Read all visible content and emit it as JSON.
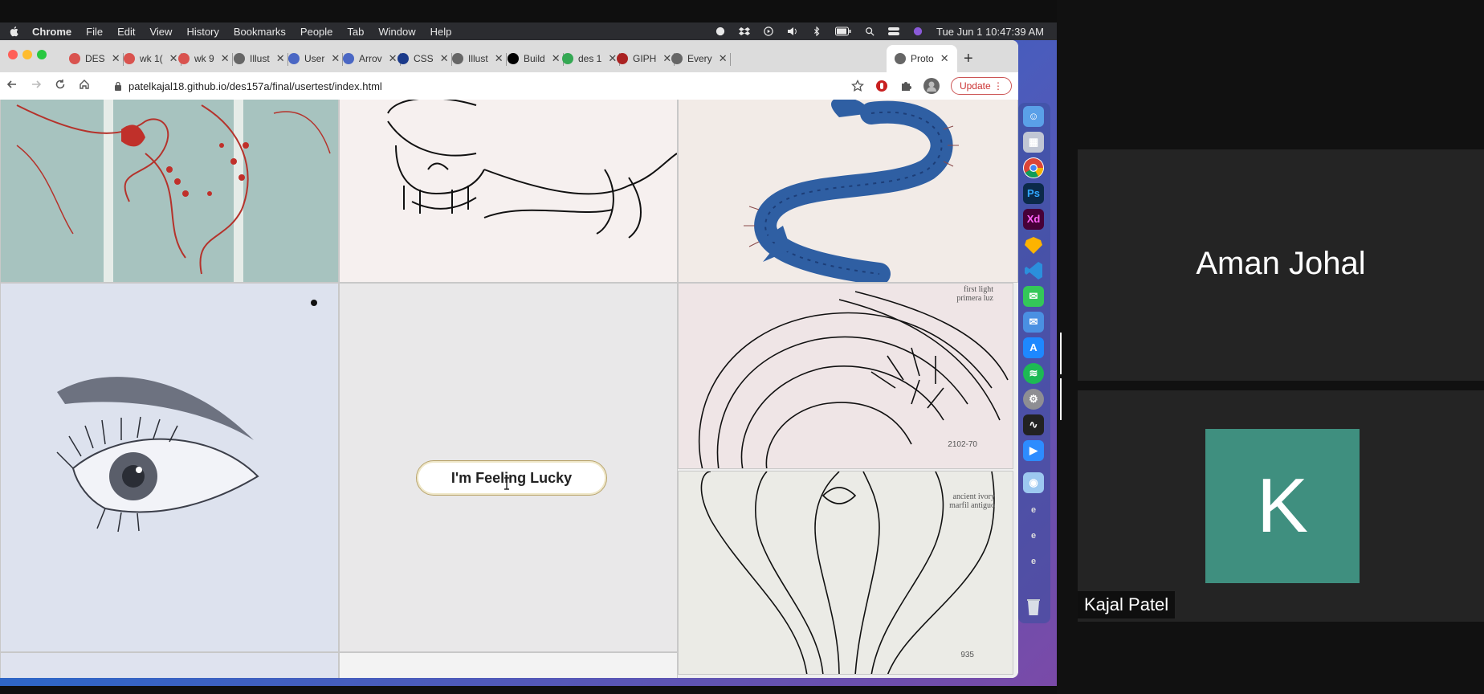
{
  "mac_menubar": {
    "app_name": "Chrome",
    "menus": [
      "File",
      "Edit",
      "View",
      "History",
      "Bookmarks",
      "People",
      "Tab",
      "Window",
      "Help"
    ],
    "clock": "Tue Jun 1  10:47:39 AM"
  },
  "chrome": {
    "tabs": [
      {
        "label": "DES",
        "favicon_color": "#d9534f"
      },
      {
        "label": "wk 1(",
        "favicon_color": "#d9534f"
      },
      {
        "label": "wk 9",
        "favicon_color": "#d9534f"
      },
      {
        "label": "Illust",
        "favicon_color": "#666666"
      },
      {
        "label": "User",
        "favicon_color": "#4a67c4"
      },
      {
        "label": "Arrov",
        "favicon_color": "#4a67c4"
      },
      {
        "label": "CSS",
        "favicon_color": "#1b3a8a"
      },
      {
        "label": "Illust",
        "favicon_color": "#666666"
      },
      {
        "label": "Build",
        "favicon_color": "#000000"
      },
      {
        "label": "des 1",
        "favicon_color": "#34a853"
      },
      {
        "label": "GIPH",
        "favicon_color": "#aa2222"
      },
      {
        "label": "Every",
        "favicon_color": "#666666"
      },
      {
        "label": "Proto",
        "favicon_color": "#666666",
        "active": true
      }
    ],
    "new_tab_glyph": "+",
    "close_glyph": "✕",
    "url": "patelkajal18.github.io/des157a/final/usertest/index.html",
    "update_label": "Update"
  },
  "page": {
    "lucky_button_label": "I'm Feeling Lucky",
    "card_texts": {
      "first_light": "first light\nprimera luz",
      "first_light_code": "2102-70",
      "ancient_ivory": "ancient ivory\nmarfil antiguo",
      "ancient_ivory_code": "935"
    }
  },
  "dock": {
    "icons": [
      "finder",
      "launchpad",
      "chrome",
      "photoshop",
      "xd",
      "sketch",
      "vscode",
      "messages",
      "mail",
      "app-store",
      "spotify",
      "system-prefs",
      "activity-monitor",
      "zoom",
      "preview",
      "docs",
      "docs",
      "docs",
      "trash"
    ],
    "ps_label": "Ps",
    "xd_label": "Xd"
  },
  "participants": [
    {
      "name": "Aman Johal"
    },
    {
      "name": "Kajal Patel",
      "avatar_letter": "K",
      "avatar_color": "#3f8f7f"
    }
  ]
}
